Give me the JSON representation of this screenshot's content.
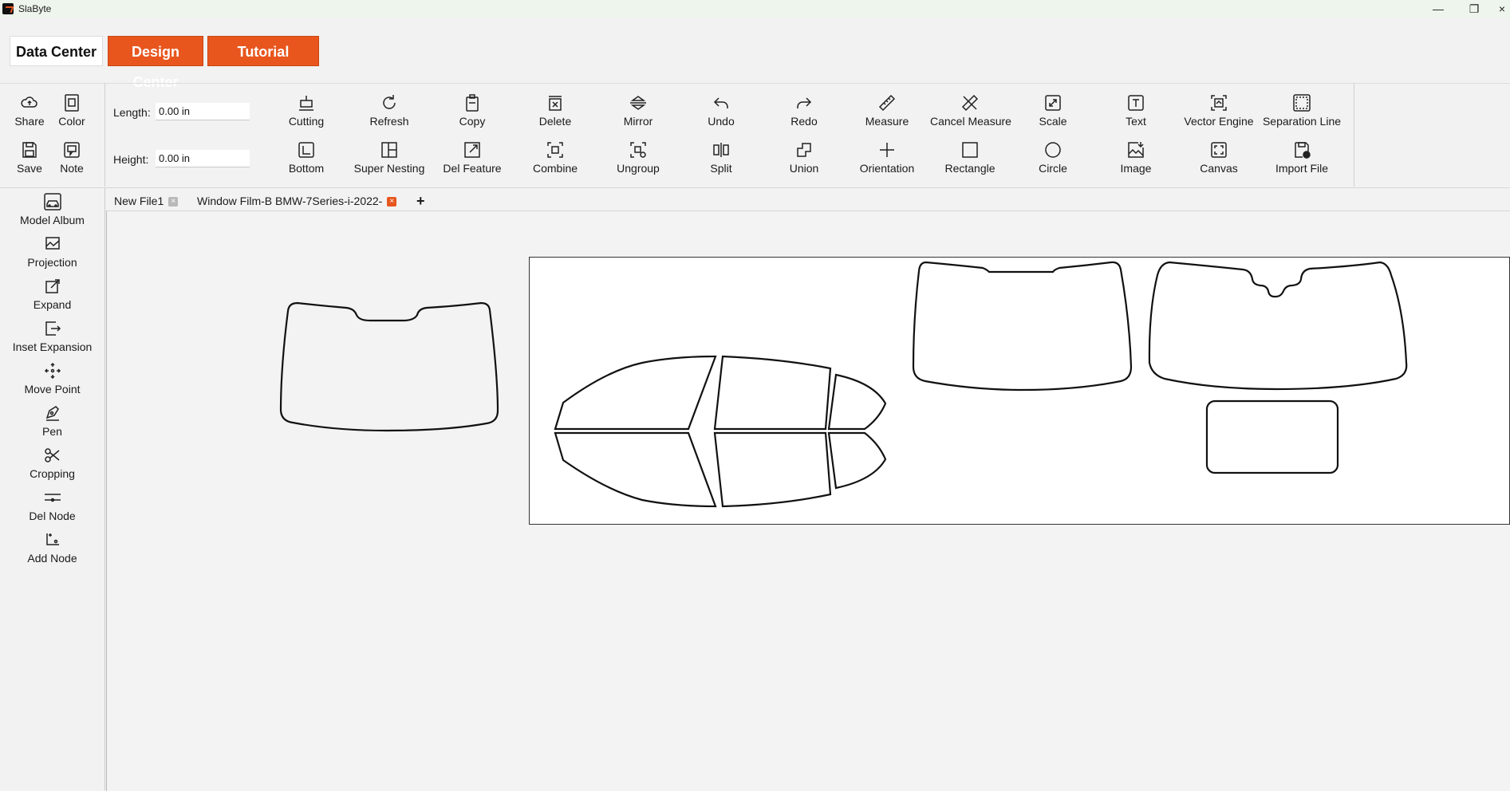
{
  "app": {
    "title": "SlaByte"
  },
  "window_controls": {
    "minimize": "—",
    "restore": "❐",
    "close": "×"
  },
  "nav_tabs": {
    "data_center": "Data Center",
    "design_center": "Design Center",
    "tutorial": "Tutorial"
  },
  "toolbar": {
    "left_tools": [
      {
        "label": "Share",
        "icon": "cloud-share-icon"
      },
      {
        "label": "Color",
        "icon": "color-icon"
      },
      {
        "label": "Save",
        "icon": "save-icon"
      },
      {
        "label": "Note",
        "icon": "note-icon"
      }
    ],
    "length": {
      "label": "Length:",
      "value": "0.00 in"
    },
    "height": {
      "label": "Height:",
      "value": "0.00 in"
    },
    "row1": [
      {
        "label": "Cutting",
        "icon": "cutting-icon"
      },
      {
        "label": "Refresh",
        "icon": "refresh-icon"
      },
      {
        "label": "Copy",
        "icon": "copy-icon"
      },
      {
        "label": "Delete",
        "icon": "delete-icon"
      },
      {
        "label": "Mirror",
        "icon": "mirror-icon"
      },
      {
        "label": "Undo",
        "icon": "undo-icon"
      },
      {
        "label": "Redo",
        "icon": "redo-icon"
      },
      {
        "label": "Measure",
        "icon": "ruler-icon"
      },
      {
        "label": "Cancel Measure",
        "icon": "cancel-ruler-icon"
      },
      {
        "label": "Scale",
        "icon": "scale-icon"
      },
      {
        "label": "Text",
        "icon": "text-icon"
      },
      {
        "label": "Vector Engine",
        "icon": "vector-engine-icon"
      },
      {
        "label": "Separation Line",
        "icon": "separation-line-icon"
      }
    ],
    "row2": [
      {
        "label": "Bottom",
        "icon": "bottom-icon"
      },
      {
        "label": "Super Nesting",
        "icon": "nesting-icon"
      },
      {
        "label": "Del Feature",
        "icon": "del-feature-icon"
      },
      {
        "label": "Combine",
        "icon": "combine-icon"
      },
      {
        "label": "Ungroup",
        "icon": "ungroup-icon"
      },
      {
        "label": "Split",
        "icon": "split-icon"
      },
      {
        "label": "Union",
        "icon": "union-icon"
      },
      {
        "label": "Orientation",
        "icon": "orientation-icon"
      },
      {
        "label": "Rectangle",
        "icon": "rectangle-icon"
      },
      {
        "label": "Circle",
        "icon": "circle-icon"
      },
      {
        "label": "Image",
        "icon": "image-icon"
      },
      {
        "label": "Canvas",
        "icon": "canvas-icon"
      },
      {
        "label": "Import File",
        "icon": "import-file-icon"
      }
    ]
  },
  "sidebar": {
    "items": [
      {
        "label": "Model Album",
        "icon": "car-album-icon"
      },
      {
        "label": "Projection",
        "icon": "projection-icon"
      },
      {
        "label": "Expand",
        "icon": "expand-icon"
      },
      {
        "label": "Inset Expansion",
        "icon": "inset-expansion-icon"
      },
      {
        "label": "Move Point",
        "icon": "move-point-icon"
      },
      {
        "label": "Pen",
        "icon": "pen-icon"
      },
      {
        "label": "Cropping",
        "icon": "scissors-icon"
      },
      {
        "label": "Del Node",
        "icon": "del-node-icon"
      },
      {
        "label": "Add Node",
        "icon": "add-node-icon"
      }
    ]
  },
  "file_tabs": [
    {
      "label": "New File1",
      "close": "×"
    },
    {
      "label": "Window Film-B BMW-7Series-i-2022-",
      "close": "×"
    }
  ],
  "add_tab": "+",
  "colors": {
    "accent": "#e8561e"
  }
}
